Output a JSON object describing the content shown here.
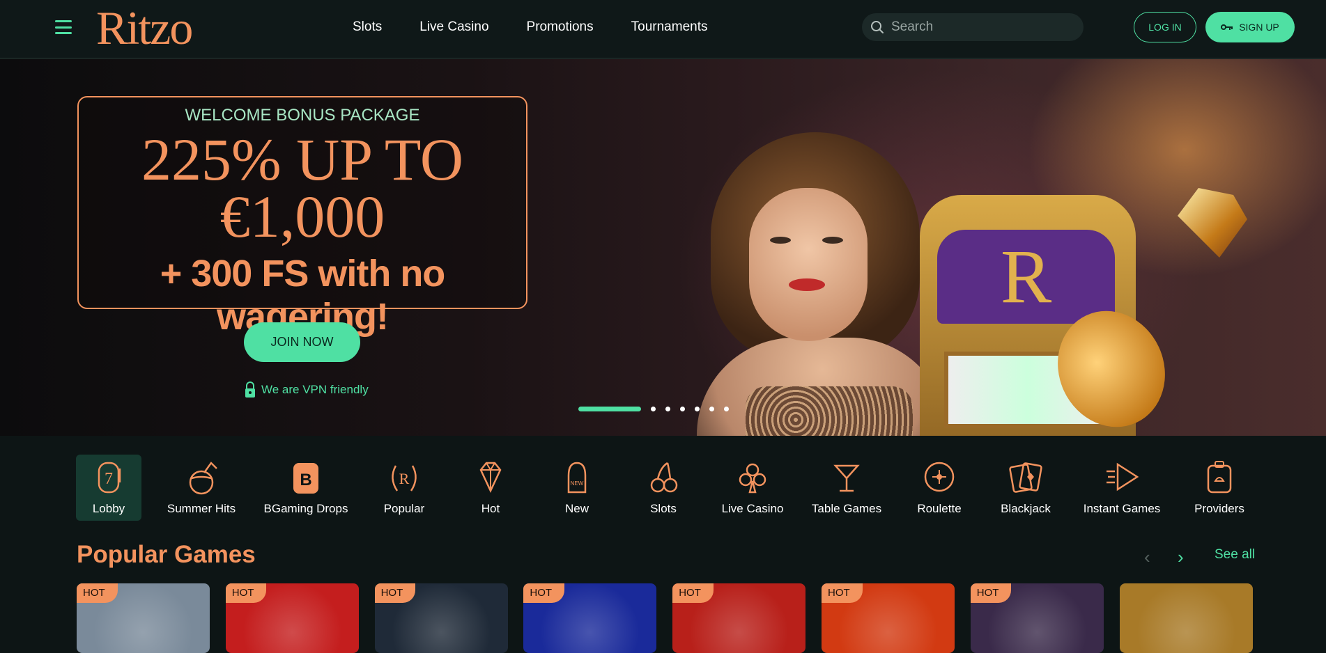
{
  "header": {
    "logo_text": "Ritzo",
    "nav": [
      "Slots",
      "Live Casino",
      "Promotions",
      "Tournaments"
    ],
    "search_placeholder": "Search",
    "login_label": "LOG IN",
    "signup_label": "SIGN UP"
  },
  "hero": {
    "subtitle": "WELCOME BONUS PACKAGE",
    "headline_line1": "225% UP TO",
    "headline_line2": "€1,000",
    "free_spins": "+ 300 FS with no wagering!",
    "cta_label": "JOIN NOW",
    "vpn_text": "We are VPN friendly",
    "slide_count": 7,
    "active_slide": 0,
    "slot_letter": "R"
  },
  "categories": [
    {
      "label": "Lobby",
      "icon": "slot-seven-icon",
      "active": true
    },
    {
      "label": "Summer Hits",
      "icon": "coconut-drink-icon",
      "active": false
    },
    {
      "label": "BGaming Drops",
      "icon": "bgaming-b-icon",
      "active": false
    },
    {
      "label": "Popular",
      "icon": "laurel-r-icon",
      "active": false
    },
    {
      "label": "Hot",
      "icon": "diamond-icon",
      "active": false
    },
    {
      "label": "New",
      "icon": "new-tag-icon",
      "active": false
    },
    {
      "label": "Slots",
      "icon": "cherries-icon",
      "active": false
    },
    {
      "label": "Live Casino",
      "icon": "club-icon",
      "active": false
    },
    {
      "label": "Table Games",
      "icon": "cocktail-icon",
      "active": false
    },
    {
      "label": "Roulette",
      "icon": "roulette-icon",
      "active": false
    },
    {
      "label": "Blackjack",
      "icon": "cards-icon",
      "active": false
    },
    {
      "label": "Instant Games",
      "icon": "instant-play-icon",
      "active": false
    },
    {
      "label": "Providers",
      "icon": "provider-bag-icon",
      "active": false
    }
  ],
  "popular": {
    "title": "Popular Games",
    "see_all": "See all",
    "badge": "HOT",
    "games": [
      {
        "badge": "HOT",
        "theme": "cowboy",
        "color": "#7a8a9a"
      },
      {
        "badge": "HOT",
        "theme": "chili",
        "color": "#c41e1e"
      },
      {
        "badge": "HOT",
        "theme": "detective",
        "color": "#1f2a38"
      },
      {
        "badge": "HOT",
        "theme": "gold-coin",
        "color": "#1a2a9a"
      },
      {
        "badge": "HOT",
        "theme": "fruits",
        "color": "#b8201a"
      },
      {
        "badge": "HOT",
        "theme": "lucky-seven",
        "color": "#d23a12"
      },
      {
        "badge": "HOT",
        "theme": "egypt",
        "color": "#3a2a4a"
      },
      {
        "badge": "",
        "theme": "crystal",
        "color": "#a87a28"
      }
    ]
  },
  "colors": {
    "accent": "#4fe0a3",
    "brand": "#f3935e",
    "background": "#0d1515"
  }
}
